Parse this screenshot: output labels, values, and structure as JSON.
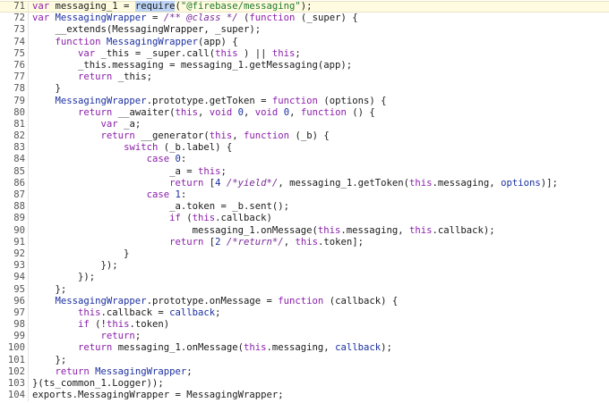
{
  "code_lines": [
    {
      "n": "71",
      "segs": [
        [
          "k",
          "var "
        ],
        [
          "",
          "messaging_1 = "
        ],
        [
          "sel",
          "require"
        ],
        [
          "",
          "("
        ],
        [
          "s",
          "\"@firebase/messaging\""
        ],
        [
          "",
          ");"
        ]
      ],
      "hl": true
    },
    {
      "n": "72",
      "segs": [
        [
          "k",
          "var "
        ],
        [
          "f",
          "MessagingWrapper"
        ],
        [
          "",
          " = "
        ],
        [
          "c",
          "/** @class */"
        ],
        [
          "",
          " ("
        ],
        [
          "k",
          "function"
        ],
        [
          "",
          " (_super) {"
        ]
      ]
    },
    {
      "n": "73",
      "segs": [
        [
          "",
          "    __extends(MessagingWrapper, _super);"
        ]
      ]
    },
    {
      "n": "74",
      "segs": [
        [
          "",
          "    "
        ],
        [
          "k",
          "function "
        ],
        [
          "f",
          "MessagingWrapper"
        ],
        [
          "",
          "(app) {"
        ]
      ]
    },
    {
      "n": "75",
      "segs": [
        [
          "",
          "        "
        ],
        [
          "k",
          "var "
        ],
        [
          "",
          "_this = _super.call("
        ],
        [
          "k",
          "this"
        ],
        [
          "",
          " ) || "
        ],
        [
          "k",
          "this"
        ],
        [
          "",
          ";"
        ]
      ]
    },
    {
      "n": "76",
      "segs": [
        [
          "",
          "        _this.messaging = messaging_1.getMessaging(app);"
        ]
      ]
    },
    {
      "n": "77",
      "segs": [
        [
          "",
          "        "
        ],
        [
          "k",
          "return "
        ],
        [
          "",
          "_this;"
        ]
      ]
    },
    {
      "n": "78",
      "segs": [
        [
          "",
          "    }"
        ]
      ]
    },
    {
      "n": "79",
      "segs": [
        [
          "",
          "    "
        ],
        [
          "f",
          "MessagingWrapper"
        ],
        [
          "",
          ".prototype.getToken = "
        ],
        [
          "k",
          "function"
        ],
        [
          "",
          " (options) {"
        ]
      ]
    },
    {
      "n": "80",
      "segs": [
        [
          "",
          "        "
        ],
        [
          "k",
          "return "
        ],
        [
          "",
          "__awaiter("
        ],
        [
          "k",
          "this"
        ],
        [
          "",
          ", "
        ],
        [
          "k",
          "void "
        ],
        [
          "n",
          "0"
        ],
        [
          "",
          ", "
        ],
        [
          "k",
          "void "
        ],
        [
          "n",
          "0"
        ],
        [
          "",
          ", "
        ],
        [
          "k",
          "function"
        ],
        [
          "",
          " () {"
        ]
      ]
    },
    {
      "n": "81",
      "segs": [
        [
          "",
          "            "
        ],
        [
          "k",
          "var "
        ],
        [
          "",
          "_a;"
        ]
      ]
    },
    {
      "n": "82",
      "segs": [
        [
          "",
          "            "
        ],
        [
          "k",
          "return "
        ],
        [
          "",
          "__generator("
        ],
        [
          "k",
          "this"
        ],
        [
          "",
          ", "
        ],
        [
          "k",
          "function"
        ],
        [
          "",
          " (_b) {"
        ]
      ]
    },
    {
      "n": "83",
      "segs": [
        [
          "",
          "                "
        ],
        [
          "k",
          "switch "
        ],
        [
          "",
          "(_b.label) {"
        ]
      ]
    },
    {
      "n": "84",
      "segs": [
        [
          "",
          "                    "
        ],
        [
          "k",
          "case "
        ],
        [
          "n",
          "0"
        ],
        [
          "",
          ":"
        ]
      ]
    },
    {
      "n": "85",
      "segs": [
        [
          "",
          "                        _a = "
        ],
        [
          "k",
          "this"
        ],
        [
          "",
          ";"
        ]
      ]
    },
    {
      "n": "86",
      "segs": [
        [
          "",
          "                        "
        ],
        [
          "k",
          "return "
        ],
        [
          "",
          "["
        ],
        [
          "n",
          "4"
        ],
        [
          "",
          " "
        ],
        [
          "c",
          "/*yield*/"
        ],
        [
          "",
          ", messaging_1.getToken("
        ],
        [
          "k",
          "this"
        ],
        [
          "",
          ".messaging, "
        ],
        [
          "f",
          "options"
        ],
        [
          "",
          ")];"
        ]
      ]
    },
    {
      "n": "87",
      "segs": [
        [
          "",
          "                    "
        ],
        [
          "k",
          "case "
        ],
        [
          "n",
          "1"
        ],
        [
          "",
          ":"
        ]
      ]
    },
    {
      "n": "88",
      "segs": [
        [
          "",
          "                        _a.token = _b.sent();"
        ]
      ]
    },
    {
      "n": "89",
      "segs": [
        [
          "",
          "                        "
        ],
        [
          "k",
          "if "
        ],
        [
          "",
          "("
        ],
        [
          "k",
          "this"
        ],
        [
          "",
          ".callback)"
        ]
      ]
    },
    {
      "n": "90",
      "segs": [
        [
          "",
          "                            messaging_1.onMessage("
        ],
        [
          "k",
          "this"
        ],
        [
          "",
          ".messaging, "
        ],
        [
          "k",
          "this"
        ],
        [
          "",
          ".callback);"
        ]
      ]
    },
    {
      "n": "91",
      "segs": [
        [
          "",
          "                        "
        ],
        [
          "k",
          "return "
        ],
        [
          "",
          "["
        ],
        [
          "n",
          "2"
        ],
        [
          "",
          " "
        ],
        [
          "c",
          "/*return*/"
        ],
        [
          "",
          ", "
        ],
        [
          "k",
          "this"
        ],
        [
          "",
          ".token];"
        ]
      ]
    },
    {
      "n": "92",
      "segs": [
        [
          "",
          "                }"
        ]
      ]
    },
    {
      "n": "93",
      "segs": [
        [
          "",
          "            });"
        ]
      ]
    },
    {
      "n": "94",
      "segs": [
        [
          "",
          "        });"
        ]
      ]
    },
    {
      "n": "95",
      "segs": [
        [
          "",
          "    };"
        ]
      ]
    },
    {
      "n": "96",
      "segs": [
        [
          "",
          "    "
        ],
        [
          "f",
          "MessagingWrapper"
        ],
        [
          "",
          ".prototype.onMessage = "
        ],
        [
          "k",
          "function"
        ],
        [
          "",
          " (callback) {"
        ]
      ]
    },
    {
      "n": "97",
      "segs": [
        [
          "",
          "        "
        ],
        [
          "k",
          "this"
        ],
        [
          "",
          ".callback = "
        ],
        [
          "f",
          "callback"
        ],
        [
          "",
          ";"
        ]
      ]
    },
    {
      "n": "98",
      "segs": [
        [
          "",
          "        "
        ],
        [
          "k",
          "if "
        ],
        [
          "",
          "(!"
        ],
        [
          "k",
          "this"
        ],
        [
          "",
          ".token)"
        ]
      ]
    },
    {
      "n": "99",
      "segs": [
        [
          "",
          "            "
        ],
        [
          "k",
          "return"
        ],
        [
          "",
          ";"
        ]
      ]
    },
    {
      "n": "100",
      "segs": [
        [
          "",
          "        "
        ],
        [
          "k",
          "return "
        ],
        [
          "",
          "messaging_1.onMessage("
        ],
        [
          "k",
          "this"
        ],
        [
          "",
          ".messaging, "
        ],
        [
          "f",
          "callback"
        ],
        [
          "",
          ");"
        ]
      ]
    },
    {
      "n": "101",
      "segs": [
        [
          "",
          "    };"
        ]
      ]
    },
    {
      "n": "102",
      "segs": [
        [
          "",
          "    "
        ],
        [
          "k",
          "return "
        ],
        [
          "f",
          "MessagingWrapper"
        ],
        [
          "",
          ";"
        ]
      ]
    },
    {
      "n": "103",
      "segs": [
        [
          "",
          "}(ts_common_1.Logger));"
        ]
      ]
    },
    {
      "n": "104",
      "segs": [
        [
          "",
          "exports.MessagingWrapper = MessagingWrapper;"
        ]
      ]
    }
  ]
}
